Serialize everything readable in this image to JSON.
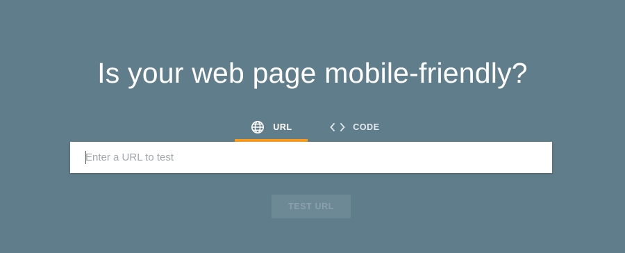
{
  "headline": "Is your web page mobile-friendly?",
  "tabs": [
    {
      "label": "URL",
      "icon": "globe-icon",
      "selected": true
    },
    {
      "label": "CODE",
      "icon": "code-icon",
      "selected": false
    }
  ],
  "url_input": {
    "placeholder": "Enter a URL to test",
    "value": ""
  },
  "test_button": {
    "label": "TEST URL",
    "enabled": false
  },
  "colors": {
    "background": "#607d8b",
    "tab_underline": "#fb9b1c",
    "input_background": "#ffffff",
    "button_disabled": "#6d8996"
  }
}
